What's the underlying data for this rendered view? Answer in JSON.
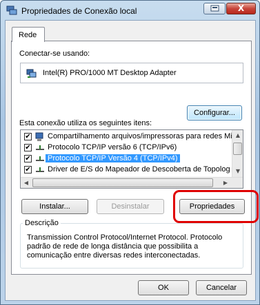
{
  "window": {
    "title": "Propriedades de Conexão local",
    "close_glyph": "X"
  },
  "tabs": [
    {
      "label": "Rede"
    }
  ],
  "connect_using": {
    "label": "Conectar-se usando:",
    "adapter": "Intel(R) PRO/1000 MT Desktop Adapter",
    "configure_label": "Configurar..."
  },
  "items_section": {
    "label": "Esta conexão utiliza os seguintes itens:",
    "items": [
      {
        "label": "Compartilhamento arquivos/impressoras para redes Mic",
        "checked": true,
        "icon": "network-client-icon"
      },
      {
        "label": "Protocolo TCP/IP versão 6 (TCP/IPv6)",
        "checked": true,
        "icon": "protocol-icon"
      },
      {
        "label": "Protocolo TCP/IP Versão 4 (TCP/IPv4)",
        "checked": true,
        "icon": "protocol-icon",
        "selected": true
      },
      {
        "label": "Driver de E/S do Mapeador de Descoberta de Topolog",
        "checked": true,
        "icon": "protocol-icon"
      }
    ],
    "check_glyph": "✔"
  },
  "actions": {
    "install": "Instalar...",
    "uninstall": "Desinstalar",
    "properties": "Propriedades"
  },
  "description": {
    "title": "Descrição",
    "text": "Transmission Control Protocol/Internet Protocol. Protocolo\npadrão de rede de longa distância que possibilita a\ncomunicação entre diversas redes interconectadas."
  },
  "footer": {
    "ok": "OK",
    "cancel": "Cancelar"
  },
  "colors": {
    "selection": "#3399ff",
    "highlight": "#e00000",
    "title_bg": "#a9c6e3"
  }
}
